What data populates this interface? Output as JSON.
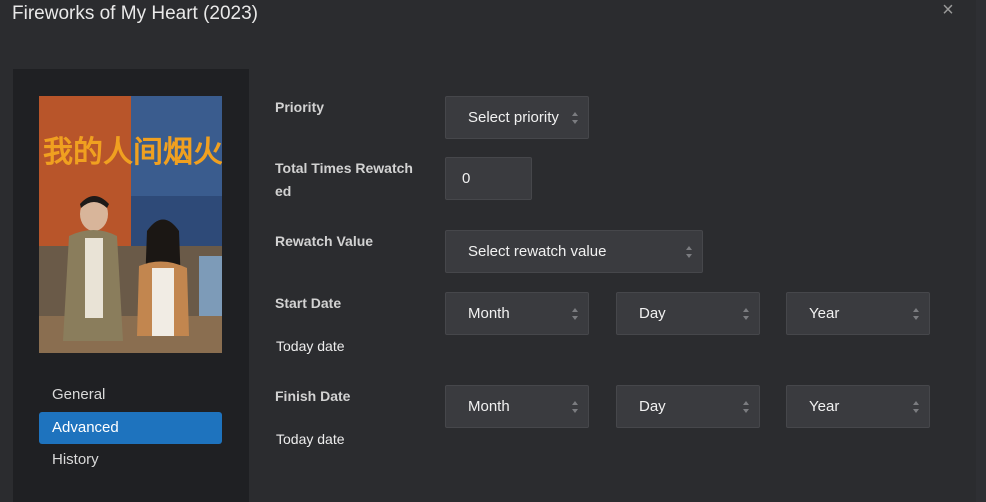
{
  "title": "Fireworks of My Heart (2023)",
  "close_glyph": "×",
  "poster": {
    "title_text": "我的人间烟火"
  },
  "nav": [
    {
      "label": "General",
      "active": false
    },
    {
      "label": "Advanced",
      "active": true
    },
    {
      "label": "History",
      "active": false
    }
  ],
  "form": {
    "priority": {
      "label": "Priority",
      "value": "Select priority"
    },
    "rewatched": {
      "label_line1": "Total Times Rewatch",
      "label_line2": "ed",
      "value": "0"
    },
    "rewatch_value": {
      "label": "Rewatch Value",
      "value": "Select rewatch value"
    },
    "start_date": {
      "label": "Start Date",
      "today": "Today date",
      "month": "Month",
      "day": "Day",
      "year": "Year"
    },
    "finish_date": {
      "label": "Finish Date",
      "today": "Today date",
      "month": "Month",
      "day": "Day",
      "year": "Year"
    }
  },
  "colors": {
    "accent": "#1e73be",
    "panel": "#1f2023",
    "field": "#3a3b3f"
  }
}
